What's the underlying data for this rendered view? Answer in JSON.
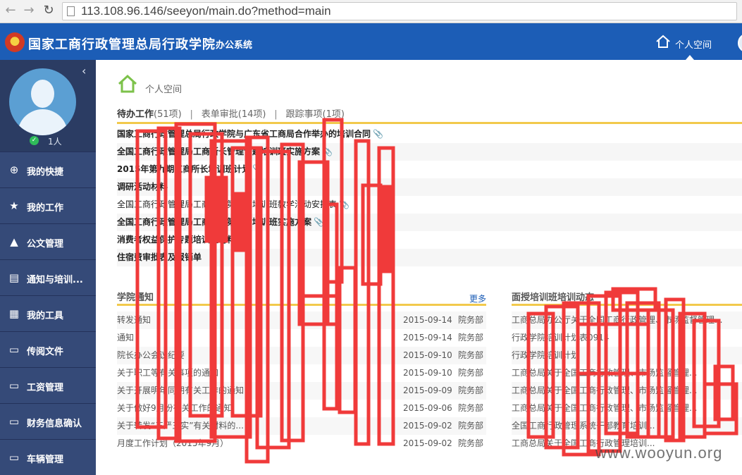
{
  "browser": {
    "url": "113.108.96.146/seeyon/main.do?method=main"
  },
  "header": {
    "org_name": "国家工商行政管理总局行政学院",
    "system_name": "办公系统",
    "personal_space_tab": "个人空间",
    "brand_color": "#1c5db6"
  },
  "sidebar": {
    "online_count": "1人",
    "items": [
      {
        "label": "我的快捷",
        "icon": "plus-circle-icon"
      },
      {
        "label": "我的工作",
        "icon": "workflow-icon"
      },
      {
        "label": "公文管理",
        "icon": "stamp-icon"
      },
      {
        "label": "通知与培训...",
        "icon": "bulletin-icon"
      },
      {
        "label": "我的工具",
        "icon": "toolbox-icon"
      },
      {
        "label": "传阅文件",
        "icon": "document-icon"
      },
      {
        "label": "工资管理",
        "icon": "document-icon"
      },
      {
        "label": "财务信息确认",
        "icon": "document-icon"
      },
      {
        "label": "车辆管理",
        "icon": "document-icon"
      }
    ]
  },
  "main": {
    "breadcrumb": "个人空间",
    "tabs": {
      "pending": "待办工作",
      "pending_count": "(51项)",
      "forms": "表单审批",
      "forms_count": "(14项)",
      "tracking": "跟踪事项",
      "tracking_count": "(1项)"
    },
    "todo_items": [
      "国家工商行政管理总局行政学院与广东省工商局合作举办的培训合同",
      "全国工商行政管理局工商所长管理专题培训班实施方案",
      "2015年第九期工商所长培训班计划",
      "调研活动材料",
      "全国工商行政管理局工商所长第三期培训班教学活动安排表",
      "全国工商行政管理局工商所长第三期培训班实施方案",
      "消费者权益保护专题培训班材料",
      "住宿费审批表及报销单"
    ],
    "news": {
      "title": "学院通知",
      "more": "更多",
      "rows": [
        {
          "title": "转发通知",
          "date": "2015-09-14",
          "dept": "院务部"
        },
        {
          "title": "通知",
          "date": "2015-09-14",
          "dept": "院务部"
        },
        {
          "title": "院长办公会议纪要",
          "date": "2015-09-10",
          "dept": "院务部"
        },
        {
          "title": "关于职工等有关事项的通知",
          "date": "2015-09-10",
          "dept": "院务部"
        },
        {
          "title": "关于开展明年同期有关工作的通知",
          "date": "2015-09-09",
          "dept": "院务部"
        },
        {
          "title": "关于做好9月份有关工作的通知",
          "date": "2015-09-06",
          "dept": "院务部"
        },
        {
          "title": "关于转发“三严三实”有关材料的...",
          "date": "2015-09-02",
          "dept": "院务部"
        },
        {
          "title": "月度工作计划（2015年9月）",
          "date": "2015-09-02",
          "dept": "院务部"
        }
      ]
    },
    "training": {
      "title": "面授培训班培训动态",
      "rows": [
        "工商总局办公厅关于全国工商行政管理、市场监督管理...",
        "行政学院培训计划表0914",
        "行政学院培训计划",
        "工商总局关于全国工商行政管理、市场监督管理...",
        "工商总局关于全国工商行政管理、市场监督管理...",
        "工商总局关于全国工商行政管理、市场监督管理...",
        "全国工商行政管理系统干部教育培训...",
        "工商总局关于全国工商行政管理培训..."
      ]
    }
  },
  "watermark": "www.wooyun.org"
}
